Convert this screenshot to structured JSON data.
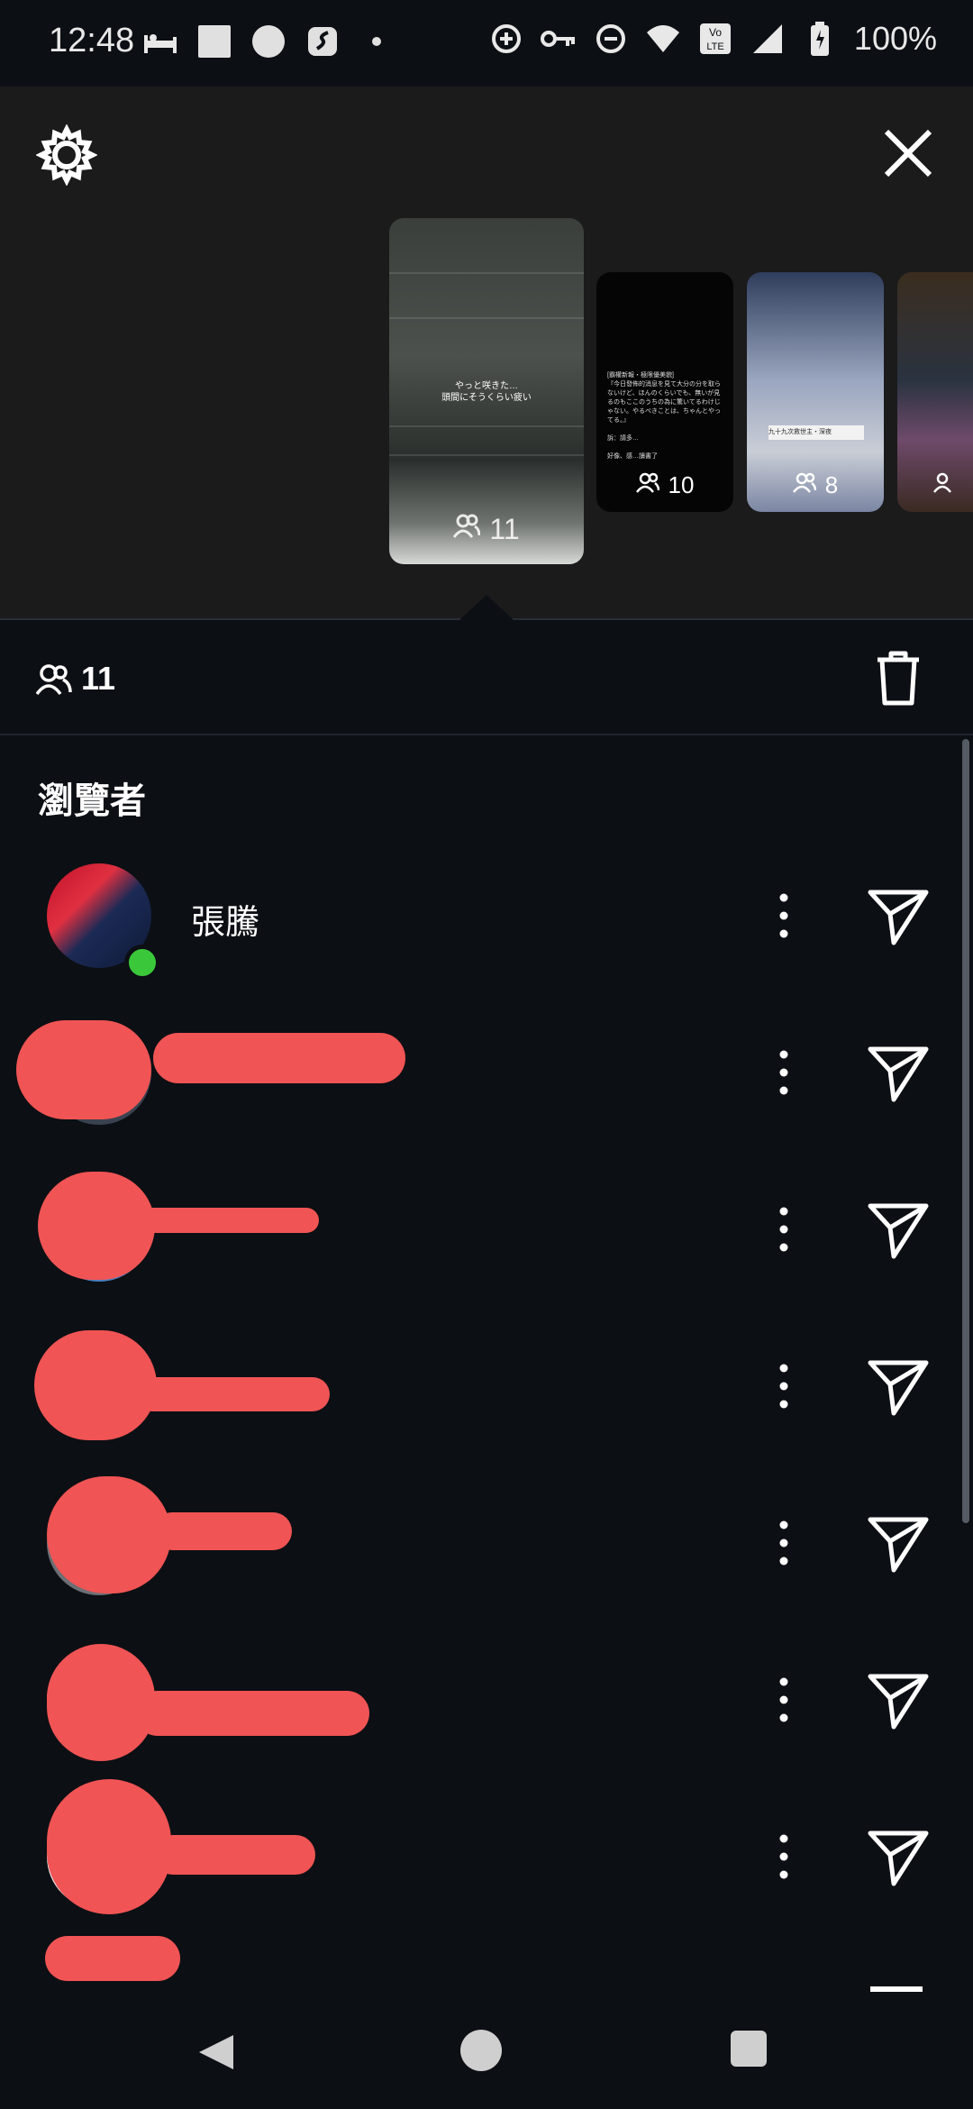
{
  "status_bar": {
    "time": "12:48",
    "left_icons": [
      "sleep-icon",
      "square-notification-icon",
      "circle-notification-icon",
      "app-notification-icon",
      "dot-icon"
    ],
    "right_icons": [
      "data-saver-icon",
      "vpn-key-icon",
      "do-not-disturb-icon",
      "wifi-icon",
      "volte-icon",
      "signal-icon",
      "battery-icon"
    ],
    "volte_label": "Vo\nLTE",
    "battery": "100%"
  },
  "panel": {
    "settings_icon": "settings-icon",
    "close_icon": "close-icon",
    "thumbnails": [
      {
        "caption": "やっと咲きた…\n頭間にそうくらい疲い",
        "count": "11"
      },
      {
        "caption": "[霸權新報・極限優美貌]\n『今日發佈的消息を見て大分の分を取らないけど、ほんのくらいでも、無いが見るのもここのうちの為に驚いてるわけじゃない。やるべきことは、ちゃんとやってる。』\n\n訴：請多…\n\n好像、感…讀書了",
        "count": "10"
      },
      {
        "caption": "九十九次救世主・深夜",
        "count": "8"
      },
      {
        "caption": "",
        "count": ""
      }
    ]
  },
  "count_bar": {
    "count": "11"
  },
  "viewers": {
    "title": "瀏覽者",
    "items": [
      {
        "name": "張騰",
        "online": true
      }
    ]
  },
  "colors": {
    "background": "#0c0f14",
    "panel": "#1b1b1c",
    "online": "#3ac83a",
    "redaction": "#f05454"
  }
}
